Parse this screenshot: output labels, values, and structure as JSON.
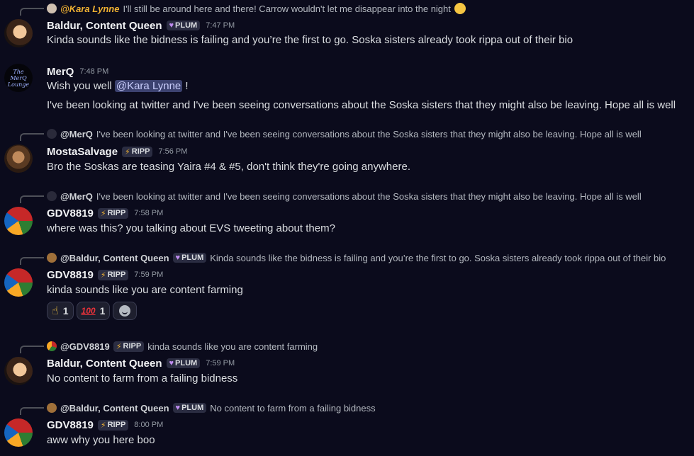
{
  "messages": [
    {
      "reply": {
        "name": "@Kara Lynne",
        "text": "I'll still be around here and there! Carrow wouldn't let me disappear into the night"
      },
      "author": "Baldur, Content Queen",
      "tag": "PLUM",
      "time": "7:47 PM",
      "lines": [
        "Kinda sounds like the bidness is failing and you’re the first to go. Soska sisters already took rippa out of their bio"
      ]
    },
    {
      "author": "MerQ",
      "time": "7:48 PM",
      "avatar_text": "The MerQ Lounge",
      "line1_prefix": "Wish you well ",
      "line1_mention": "@Kara Lynne",
      "line1_suffix": " !",
      "lines": [
        "I've been looking at twitter and I've been seeing conversations about the Soska sisters that they might also be leaving. Hope all is well"
      ]
    },
    {
      "reply": {
        "name": "@MerQ",
        "text": "I've been looking at twitter and I've been seeing conversations about the Soska sisters that they might also be leaving. Hope all is well"
      },
      "author": "MostaSalvage",
      "tag": "RIPP",
      "time": "7:56 PM",
      "lines": [
        "Bro the Soskas are teasing Yaira #4 & #5, don't think they're going anywhere."
      ]
    },
    {
      "reply": {
        "name": "@MerQ",
        "text": "I've been looking at twitter and I've been seeing conversations about the Soska sisters that they might also be leaving. Hope all is well"
      },
      "author": "GDV8819",
      "tag": "RIPP",
      "time": "7:58 PM",
      "lines": [
        "where was this? you talking about EVS tweeting about them?"
      ]
    },
    {
      "reply": {
        "name": "@Baldur, Content Queen",
        "tag": "PLUM",
        "text": "Kinda sounds like the bidness is failing and you’re the first to go. Soska sisters already took rippa out of their bio"
      },
      "author": "GDV8819",
      "tag": "RIPP",
      "time": "7:59 PM",
      "lines": [
        "kinda sounds like you are content farming"
      ],
      "reactions": [
        {
          "emoji": "point-up",
          "count": "1"
        },
        {
          "emoji": "hundred",
          "glyph": "100",
          "count": "1"
        }
      ]
    },
    {
      "reply": {
        "name": "@GDV8819",
        "tag": "RIPP",
        "text": "kinda sounds like you are content farming"
      },
      "author": "Baldur, Content Queen",
      "tag": "PLUM",
      "time": "7:59 PM",
      "lines": [
        "No content to farm from a failing bidness"
      ]
    },
    {
      "reply": {
        "name": "@Baldur, Content Queen",
        "tag": "PLUM",
        "text": "No content to farm from a failing bidness"
      },
      "author": "GDV8819",
      "tag": "RIPP",
      "time": "8:00 PM",
      "lines": [
        "aww why you here boo"
      ]
    }
  ],
  "colors": {
    "background": "#0b0b1c",
    "plum": "#c08cf0",
    "ripp": "#f0b132",
    "mention": "#c9cdfb"
  }
}
